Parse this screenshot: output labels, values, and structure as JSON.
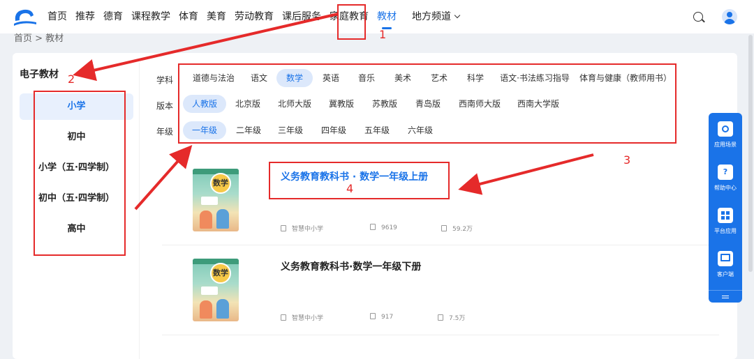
{
  "nav": {
    "items": [
      "首页",
      "推荐",
      "德育",
      "课程教学",
      "体育",
      "美育",
      "劳动教育",
      "课后服务",
      "家庭教育",
      "教材",
      "地方频道"
    ],
    "active_index": 9
  },
  "breadcrumb": "首页 > 教材",
  "sidebar": {
    "title": "电子教材",
    "items": [
      "小学",
      "初中",
      "小学（五·四学制）",
      "初中（五·四学制）",
      "高中"
    ],
    "active_index": 0
  },
  "filters": {
    "subject_label": "学科",
    "subjects": [
      "道德与法治",
      "语文",
      "数学",
      "英语",
      "音乐",
      "美术",
      "艺术",
      "科学",
      "语文·书法练习指导",
      "体育与健康（教师用书）"
    ],
    "subject_active": "数学",
    "edition_label": "版本",
    "editions": [
      "人教版",
      "北京版",
      "北师大版",
      "冀教版",
      "苏教版",
      "青岛版",
      "西南师大版",
      "西南大学版"
    ],
    "edition_active": "人教版",
    "grade_label": "年级",
    "grades": [
      "一年级",
      "二年级",
      "三年级",
      "四年级",
      "五年级",
      "六年级"
    ],
    "grade_active": "一年级"
  },
  "books": [
    {
      "title": "义务教育教科书 · 数学一年级上册",
      "cover_label": "数学",
      "publisher": "智慧中小学",
      "likes": "9619",
      "views": "59.2万"
    },
    {
      "title": "义务教育教科书·数学一年级下册",
      "cover_label": "数学",
      "publisher": "智慧中小学",
      "likes": "917",
      "views": "7.5万"
    }
  ],
  "float_panel": {
    "items": [
      "应用场景",
      "帮助中心",
      "平台应用",
      "客户端"
    ]
  },
  "annotations": [
    "1",
    "2",
    "3",
    "4"
  ],
  "colors": {
    "accent": "#1a73e8",
    "annotation": "#e52a2a"
  }
}
